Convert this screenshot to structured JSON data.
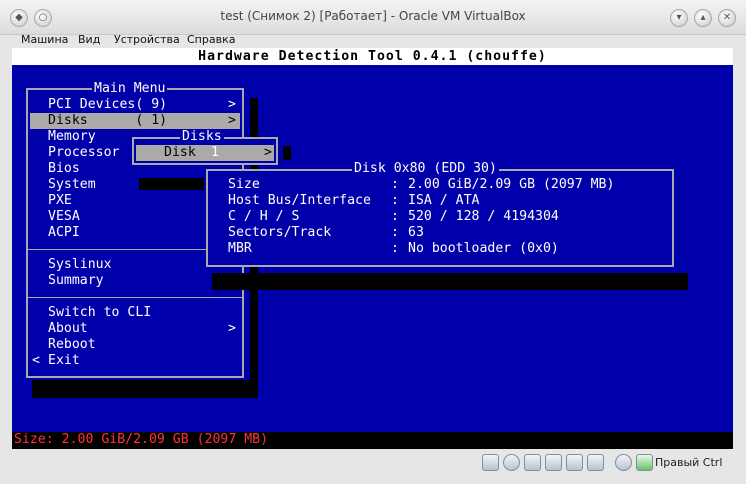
{
  "window": {
    "title": "test (Снимок 2) [Работает] - Oracle VM VirtualBox"
  },
  "menubar": [
    "Машина",
    "Вид",
    "Устройства",
    "Справка"
  ],
  "header": "Hardware Detection Tool 0.4.1 (chouffe)",
  "main_menu": {
    "title": "Main Menu",
    "items": [
      "PCI Devices( 9)",
      "Disks      ( 1)",
      "Memory",
      "Processor",
      "Bios",
      "System",
      "PXE",
      "VESA",
      "ACPI"
    ],
    "items2": [
      "Syslinux",
      "Summary"
    ],
    "items3": [
      "Switch to CLI",
      "About",
      "Reboot",
      "Exit"
    ]
  },
  "disks_menu": {
    "title": "Disks",
    "item": "Disk",
    "item_number": "1"
  },
  "disk_info": {
    "title": "Disk 0x80 (EDD 30)",
    "rows": [
      {
        "label": "Size",
        "value": "2.00 GiB/2.09 GB (2097 MB)"
      },
      {
        "label": "Host Bus/Interface",
        "value": "ISA / ATA"
      },
      {
        "label": "C / H / S",
        "value": "520 / 128 / 4194304"
      },
      {
        "label": "Sectors/Track",
        "value": "63"
      },
      {
        "label": "MBR",
        "value": "No bootloader (0x0)"
      }
    ]
  },
  "status_line": "Size: 2.00 GiB/2.09 GB (2097 MB)",
  "statusbar": {
    "host_key": "Правый Ctrl"
  },
  "colors": {
    "screen_bg": "#0000aa",
    "highlight": "#aaaaaa",
    "status_text": "#ff3333"
  }
}
